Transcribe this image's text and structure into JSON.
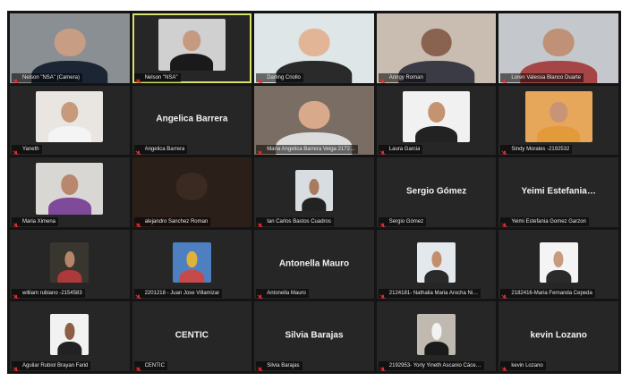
{
  "gallery": {
    "tiles": [
      {
        "name": "Nelson \"NSA\" (Camera)",
        "kind": "video",
        "fit": "full",
        "bg": "#8a8f93",
        "skin": "#c79d84",
        "shirt": "#1c2533",
        "active": false
      },
      {
        "name": "Nelson \"NSA\"",
        "kind": "video",
        "fit": "mid",
        "bg": "#d0d0d0",
        "skin": "#c69a80",
        "shirt": "#1a1a1a",
        "active": true
      },
      {
        "name": "Darling Criollo",
        "kind": "video",
        "fit": "full",
        "bg": "#dfe6e7",
        "skin": "#e2b597",
        "shirt": "#2a2a2a",
        "active": false
      },
      {
        "name": "Anngy Roman",
        "kind": "video",
        "fit": "full",
        "bg": "#c9bcb0",
        "skin": "#8a6350",
        "shirt": "#3b3b46",
        "active": false
      },
      {
        "name": "Loren Valessa Blanco Duarte",
        "kind": "video",
        "fit": "full",
        "bg": "#c4c8cc",
        "skin": "#bf9176",
        "shirt": "#a64545",
        "active": false
      },
      {
        "name": "Yaneth",
        "kind": "video",
        "fit": "mid",
        "bg": "#e9e6e2",
        "skin": "#c79a7c",
        "shirt": "#f4f4f4",
        "active": false
      },
      {
        "name": "Angelica Barrera",
        "kind": "text",
        "center": "Angelica Barrera",
        "active": false
      },
      {
        "name": "Maria Angelica Barrera Veiga 2172…",
        "kind": "video",
        "fit": "full",
        "bg": "#7a6d63",
        "skin": "#d8a98a",
        "shirt": "#dcdcdc",
        "active": false
      },
      {
        "name": "Laura Garcia",
        "kind": "video",
        "fit": "mid",
        "bg": "#f1f1f1",
        "skin": "#c4936f",
        "shirt": "#222222",
        "active": false
      },
      {
        "name": "Sindy Morales -2192532",
        "kind": "video",
        "fit": "mid",
        "bg": "#e7a75a",
        "skin": "#c89477",
        "shirt": "#e39a3b",
        "active": false
      },
      {
        "name": "Maria Ximena",
        "kind": "video",
        "fit": "mid",
        "bg": "#d9d7d3",
        "skin": "#b8876d",
        "shirt": "#7f4a9a",
        "active": false
      },
      {
        "name": "alejandro Sanchez Roman",
        "kind": "video",
        "fit": "full",
        "bg": "#2b1f1a",
        "skin": "#3a2a22",
        "shirt": "#2b1f1a",
        "active": false
      },
      {
        "name": "Ian Carlos Bastos Cuadros",
        "kind": "video",
        "fit": "small",
        "bg": "#d7dde0",
        "skin": "#a97a5e",
        "shirt": "#222222",
        "active": false
      },
      {
        "name": "Sergio  Gómez",
        "kind": "text",
        "center": "Sergio  Gómez",
        "active": false
      },
      {
        "name": "Yeimi Estefania Gomez Garzon",
        "kind": "text",
        "center": "Yeimi Estefania…",
        "active": false
      },
      {
        "name": "william  rubiano -2154583",
        "kind": "video",
        "fit": "small",
        "bg": "#39362f",
        "skin": "#b7866a",
        "shirt": "#ad3a3a",
        "active": false
      },
      {
        "name": "2201218 - Juan Jose Villamizar",
        "kind": "video",
        "fit": "small",
        "bg": "#4e7fc0",
        "skin": "#e0b23b",
        "shirt": "#c74a4a",
        "active": false
      },
      {
        "name": "Antonella Mauro",
        "kind": "text",
        "center": "Antonella Mauro",
        "active": false
      },
      {
        "name": "2124181- Nathalia Maria Arocha Ni…",
        "kind": "video",
        "fit": "small",
        "bg": "#e3e8ec",
        "skin": "#c28e6e",
        "shirt": "#2a2a2a",
        "active": false
      },
      {
        "name": "2182416-Maria Fernanda Cepeda",
        "kind": "video",
        "fit": "small",
        "bg": "#f4f4f4",
        "skin": "#c89a80",
        "shirt": "#2a2a2a",
        "active": false
      },
      {
        "name": "Aguilar Rubiol Brayan Farid",
        "kind": "video",
        "fit": "small",
        "bg": "#f2f2f2",
        "skin": "#8d5f45",
        "shirt": "#222222",
        "active": false
      },
      {
        "name": "CENTIC",
        "kind": "text",
        "center": "CENTIC",
        "active": false
      },
      {
        "name": "Silvia Barajas",
        "kind": "text",
        "center": "Silvia Barajas",
        "active": false
      },
      {
        "name": "2192953- Yorly Yineth Ascanio Cáce…",
        "kind": "video",
        "fit": "small",
        "bg": "#bfb9b0",
        "skin": "#f2f2f2",
        "shirt": "#1a1a1a",
        "active": false
      },
      {
        "name": "kevin Lozano",
        "kind": "text",
        "center": "kevin Lozano",
        "active": false
      }
    ],
    "mute_color": "#e02f2f",
    "active_border": "#d6e26a",
    "tile_bg": "#262626",
    "mute_icon": "microphone-muted-icon"
  }
}
